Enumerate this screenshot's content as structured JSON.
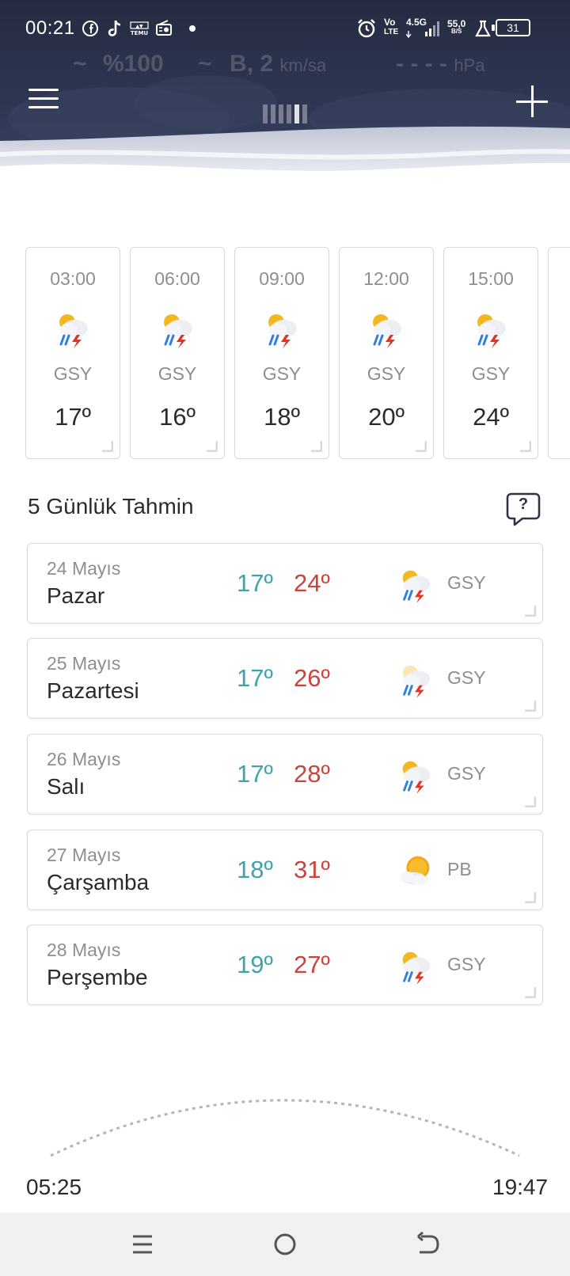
{
  "status_bar": {
    "time": "00:21",
    "net_top": "Vo",
    "net_bottom": "LTE",
    "network_gen": "4.5G",
    "speed_value": "55,0",
    "speed_unit": "B/S",
    "battery": "31"
  },
  "header": {
    "ghost_humidity": "%100",
    "ghost_wind": "B, 2",
    "ghost_wind_unit": "km/sa",
    "ghost_pressure": "- - - -",
    "ghost_pressure_unit": "hPa"
  },
  "hourly": [
    {
      "time": "03:00",
      "icon": "thunderstorm-icon",
      "condition": "GSY",
      "temp": "17º"
    },
    {
      "time": "06:00",
      "icon": "thunderstorm-icon",
      "condition": "GSY",
      "temp": "16º"
    },
    {
      "time": "09:00",
      "icon": "thunderstorm-icon",
      "condition": "GSY",
      "temp": "18º"
    },
    {
      "time": "12:00",
      "icon": "thunderstorm-icon",
      "condition": "GSY",
      "temp": "20º"
    },
    {
      "time": "15:00",
      "icon": "thunderstorm-icon",
      "condition": "GSY",
      "temp": "24º"
    }
  ],
  "forecast": {
    "title": "5 Günlük Tahmin",
    "help_symbol": "?",
    "days": [
      {
        "date": "24 Mayıs",
        "day": "Pazar",
        "low": "17º",
        "high": "24º",
        "icon": "thunderstorm-icon",
        "condition": "GSY"
      },
      {
        "date": "25 Mayıs",
        "day": "Pazartesi",
        "low": "17º",
        "high": "26º",
        "icon": "thunderstorm-icon",
        "condition": "GSY"
      },
      {
        "date": "26 Mayıs",
        "day": "Salı",
        "low": "17º",
        "high": "28º",
        "icon": "thunderstorm-icon",
        "condition": "GSY"
      },
      {
        "date": "27 Mayıs",
        "day": "Çarşamba",
        "low": "18º",
        "high": "31º",
        "icon": "partly-cloudy-icon",
        "condition": "PB"
      },
      {
        "date": "28 Mayıs",
        "day": "Perşembe",
        "low": "19º",
        "high": "27º",
        "icon": "thunderstorm-icon",
        "condition": "GSY"
      }
    ]
  },
  "sun": {
    "sunrise": "05:25",
    "sunset": "19:47"
  },
  "colors": {
    "header_dark": "#2a3048",
    "low_temp": "#3ea3ad",
    "high_temp": "#c9443a",
    "muted": "#8a8f94"
  }
}
